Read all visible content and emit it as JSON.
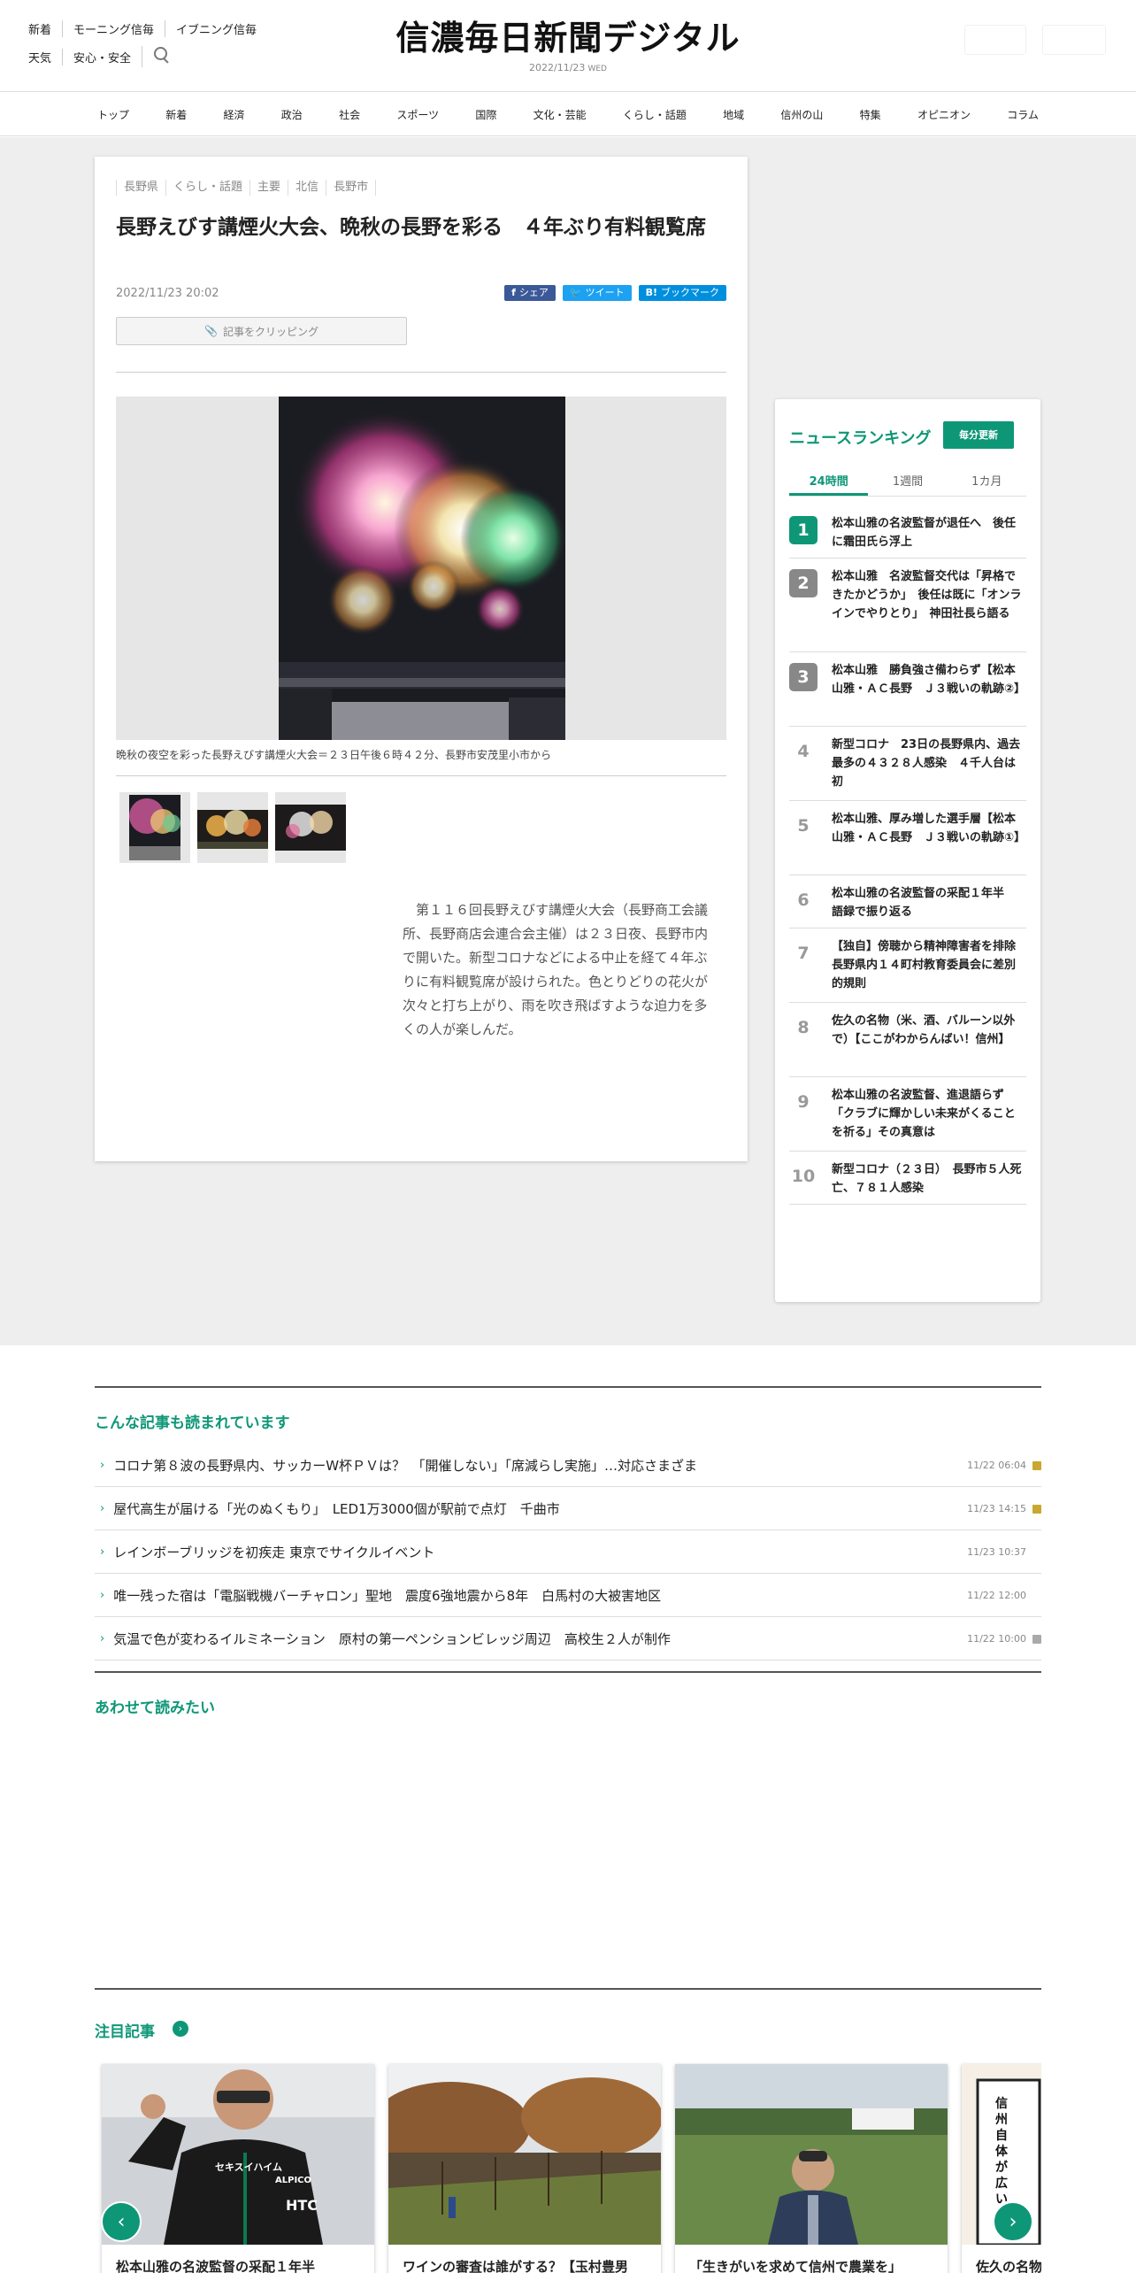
{
  "header": {
    "links_row1": [
      "新着",
      "モーニング信毎",
      "イブニング信毎"
    ],
    "links_row2": [
      "天気",
      "安心・安全"
    ],
    "logo": "信濃毎日新聞デジタル",
    "date": "2022/11/23",
    "weekday": "WED"
  },
  "nav": [
    "トップ",
    "新着",
    "経済",
    "政治",
    "社会",
    "スポーツ",
    "国際",
    "文化・芸能",
    "くらし・話題",
    "地域",
    "信州の山",
    "特集",
    "オピニオン",
    "コラム"
  ],
  "article": {
    "tags": [
      "長野県",
      "くらし・話題",
      "主要",
      "北信",
      "長野市"
    ],
    "headline": "長野えびす講煙火大会、晩秋の長野を彩る　４年ぶり有料観覧席",
    "datetime": "2022/11/23 20:02",
    "share": {
      "facebook": "シェア",
      "twitter": "ツイート",
      "hatena": "ブックマーク"
    },
    "clip_label": "記事をクリッピング",
    "caption": "晩秋の夜空を彩った長野えびす講煙火大会＝２３日午後６時４２分、長野市安茂里小市から",
    "body": "　第１１６回長野えびす講煙火大会（長野商工会議所、長野商店会連合会主催）は２３日夜、長野市内で開いた。新型コロナなどによる中止を経て４年ぶりに有料観覧席が設けられた。色とりどりの花火が次々と打ち上がり、雨を吹き飛ばすような迫力を多くの人が楽しんだ。"
  },
  "ranking": {
    "title": "ニュースランキング",
    "badge": "毎分更新",
    "tabs": [
      "24時間",
      "1週間",
      "1カ月"
    ],
    "items": [
      {
        "rank": "1",
        "title": "松本山雅の名波監督が退任へ　後任に霜田氏ら浮上"
      },
      {
        "rank": "2",
        "title": "松本山雅　名波監督交代は「昇格できたかどうか」　後任は既に「オンラインでやりとり」　神田社長ら語る"
      },
      {
        "rank": "3",
        "title": "松本山雅　勝負強さ備わらず【松本山雅・ＡＣ長野　Ｊ３戦いの軌跡②】"
      },
      {
        "rank": "4",
        "title": "新型コロナ　23日の長野県内、過去最多の４３２８人感染　４千人台は初"
      },
      {
        "rank": "5",
        "title": "松本山雅、厚み増した選手層【松本山雅・ＡＣ長野　Ｊ３戦いの軌跡①】"
      },
      {
        "rank": "6",
        "title": "松本山雅の名波監督の采配１年半　語録で振り返る"
      },
      {
        "rank": "7",
        "title": "【独自】傍聴から精神障害者を排除　長野県内１４町村教育委員会に差別的規則"
      },
      {
        "rank": "8",
        "title": "佐久の名物（米、酒、バルーン以外で）【ここがわからんばい！信州】"
      },
      {
        "rank": "9",
        "title": "松本山雅の名波監督、進退語らず「クラブに輝かしい未来がくることを祈る」その真意は"
      },
      {
        "rank": "10",
        "title": "新型コロナ（２３日）　長野市５人死亡、７８１人感染"
      }
    ]
  },
  "popular": {
    "title": "こんな記事も読まれています",
    "items": [
      {
        "title": "コロナ第８波の長野県内、サッカーW杯ＰＶは？　「開催しない」「席減らし実施」…対応さまざま",
        "date": "11/22 06:04",
        "lock": "gold"
      },
      {
        "title": "屋代高生が届ける「光のぬくもり」　LED1万3000個が駅前で点灯　千曲市",
        "date": "11/23 14:15",
        "lock": "gold"
      },
      {
        "title": "レインボーブリッジを初疾走 東京でサイクルイベント",
        "date": "11/23 10:37",
        "lock": "none"
      },
      {
        "title": "唯一残った宿は「電脳戦機バーチャロン」聖地　震度6強地震から8年　白馬村の大被害地区",
        "date": "11/22 12:00",
        "lock": "none"
      },
      {
        "title": "気温で色が変わるイルミネーション　原村の第一ペンションビレッジ周辺　高校生２人が制作",
        "date": "11/22 10:00",
        "lock": "grey"
      }
    ]
  },
  "also_read": {
    "title": "あわせて読みたい"
  },
  "featured": {
    "title": "注目記事",
    "cards": [
      {
        "title": "松本山雅の名波監督の采配１年半"
      },
      {
        "title": "ワインの審査は誰がする？【玉村豊男"
      },
      {
        "title": "「生きがいを求めて信州で農業を」"
      },
      {
        "title": "佐久の名物"
      }
    ],
    "manga_text": "信州自体が広い",
    "shirt_text": [
      "セキスイハイム",
      "ALPICO",
      "HTC"
    ]
  },
  "colors": {
    "accent": "#0e9777",
    "facebook": "#3b5998",
    "twitter": "#1da1f2",
    "hatena": "#008fde"
  }
}
